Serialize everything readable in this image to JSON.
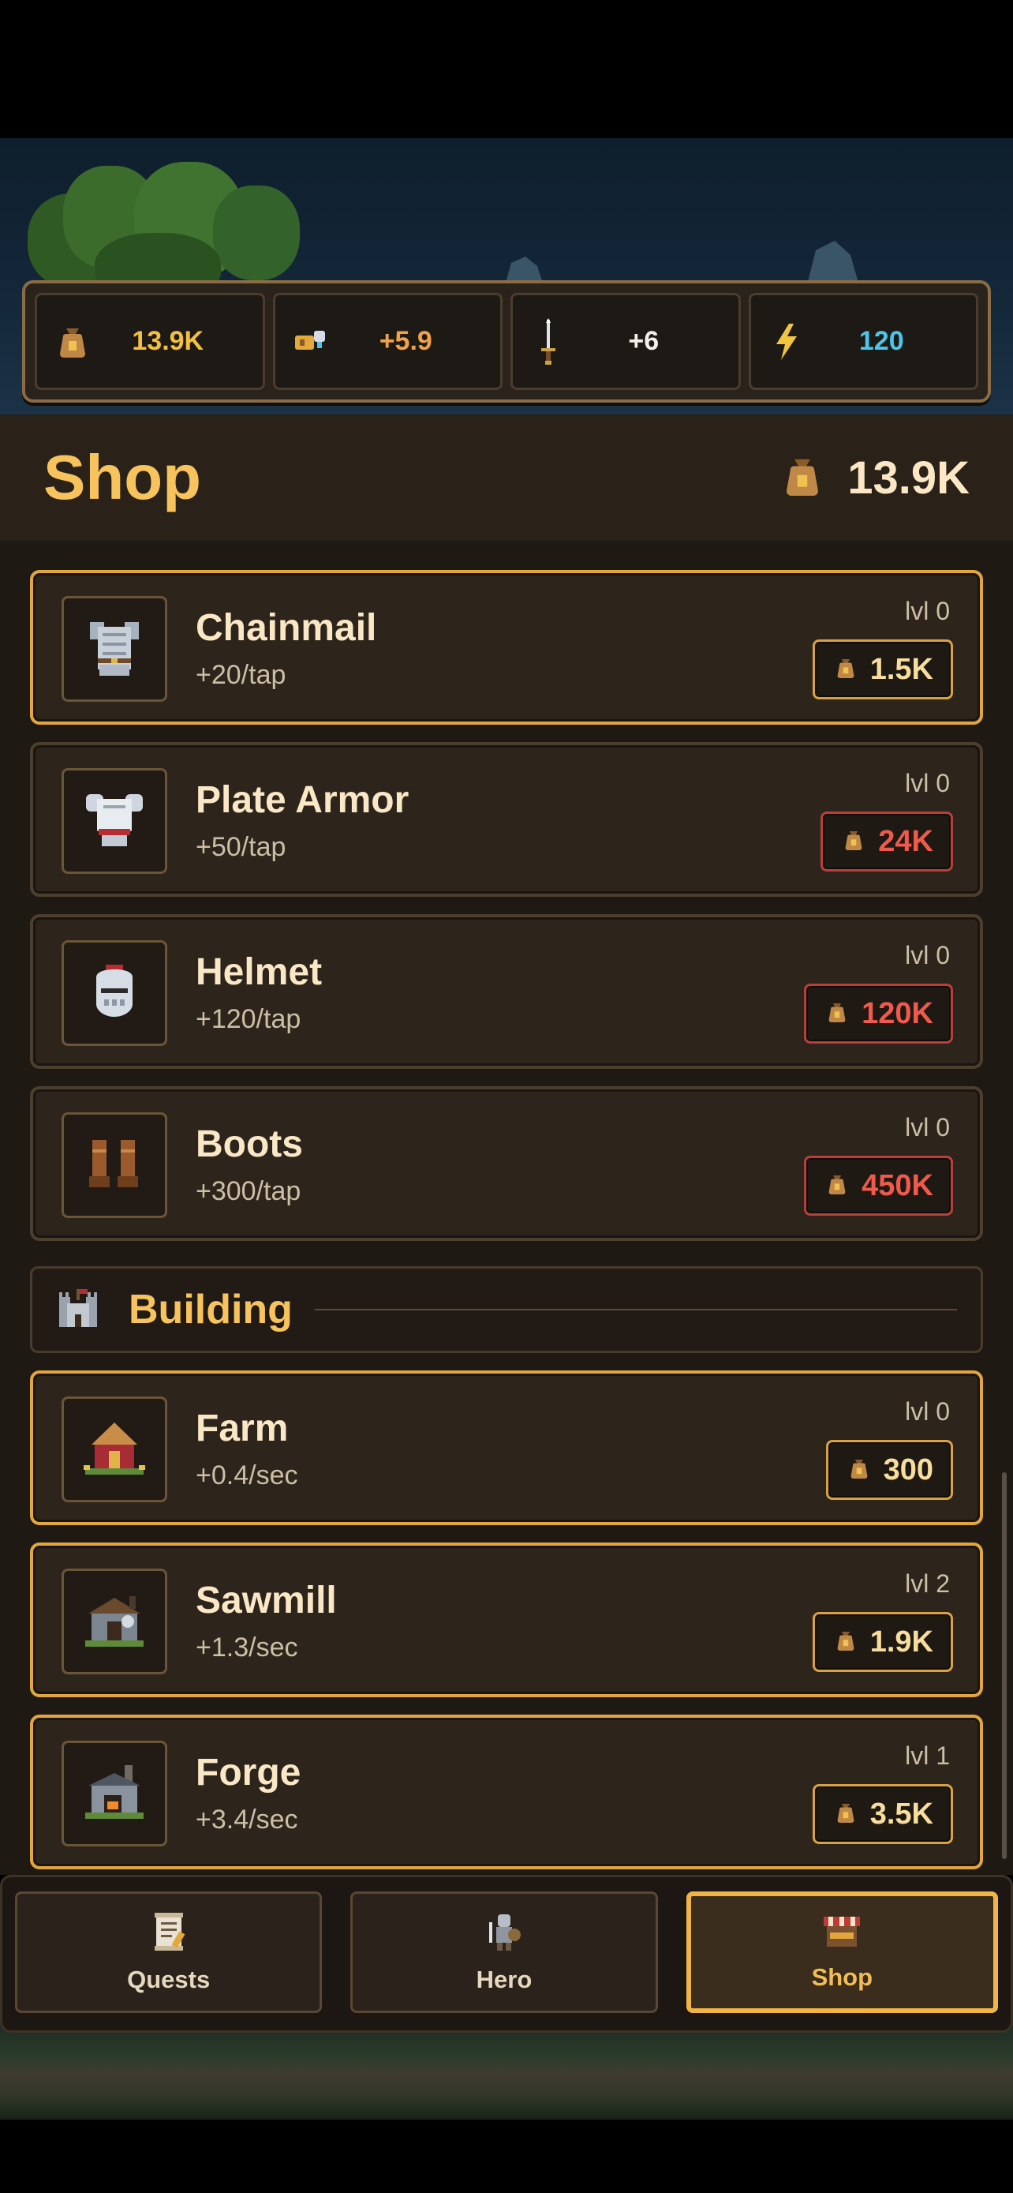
{
  "stats": {
    "gold": {
      "value": "13.9K",
      "icon": "gold-bag-icon",
      "color": "#f3c13d"
    },
    "income": {
      "value": "+5.9",
      "icon": "coin-income-icon",
      "color": "#f0a24a"
    },
    "tap": {
      "value": "+6",
      "icon": "sword-icon",
      "color": "#f4efe6"
    },
    "energy": {
      "value": "120",
      "icon": "lightning-icon",
      "color": "#4bc6ea"
    }
  },
  "shop": {
    "title": "Shop",
    "gold": "13.9K"
  },
  "items": [
    {
      "name": "Chainmail",
      "rate": "+20/tap",
      "level": "lvl 0",
      "price": "1.5K",
      "affordable": true,
      "icon": "chainmail-icon"
    },
    {
      "name": "Plate Armor",
      "rate": "+50/tap",
      "level": "lvl 0",
      "price": "24K",
      "affordable": false,
      "icon": "plate-armor-icon"
    },
    {
      "name": "Helmet",
      "rate": "+120/tap",
      "level": "lvl 0",
      "price": "120K",
      "affordable": false,
      "icon": "helmet-icon"
    },
    {
      "name": "Boots",
      "rate": "+300/tap",
      "level": "lvl 0",
      "price": "450K",
      "affordable": false,
      "icon": "boots-icon"
    }
  ],
  "building_section": {
    "title": "Building",
    "icon": "castle-icon"
  },
  "buildings": [
    {
      "name": "Farm",
      "rate": "+0.4/sec",
      "level": "lvl 0",
      "price": "300",
      "affordable": true,
      "icon": "farm-icon"
    },
    {
      "name": "Sawmill",
      "rate": "+1.3/sec",
      "level": "lvl 2",
      "price": "1.9K",
      "affordable": true,
      "icon": "sawmill-icon"
    },
    {
      "name": "Forge",
      "rate": "+3.4/sec",
      "level": "lvl 1",
      "price": "3.5K",
      "affordable": true,
      "icon": "forge-icon"
    }
  ],
  "nav": {
    "tabs": [
      {
        "label": "Quests",
        "icon": "scroll-icon",
        "active": false
      },
      {
        "label": "Hero",
        "icon": "hero-icon",
        "active": false
      },
      {
        "label": "Shop",
        "icon": "shop-stall-icon",
        "active": true
      }
    ]
  }
}
